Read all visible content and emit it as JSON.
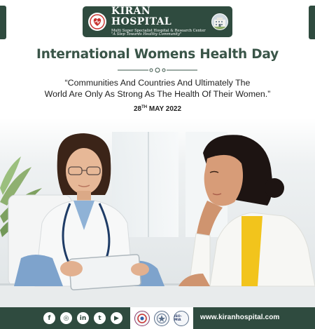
{
  "header": {
    "brand_name": "KIRAN HOSPITAL",
    "subtitle": "Multi Super Specialist Hospital & Research Center",
    "tagline": "\"A Step Towards Healthy Community\"",
    "logo_icon": "kiran-heart-logo-icon",
    "building_icon": "hospital-building-icon"
  },
  "title": "International Womens Health Day",
  "quote": {
    "line1": "“Communities And Countries And Ultimately The",
    "line2": "World Are Only As Strong As The Health Of Their Women.”"
  },
  "date": {
    "day": "28",
    "suffix": "TH",
    "rest": " MAY 2022"
  },
  "footer": {
    "social": [
      {
        "glyph": "f",
        "icon": "facebook-icon"
      },
      {
        "glyph": "◎",
        "icon": "instagram-icon"
      },
      {
        "glyph": "in",
        "icon": "linkedin-icon"
      },
      {
        "glyph": "t",
        "icon": "twitter-icon"
      },
      {
        "glyph": "▶",
        "icon": "youtube-icon"
      }
    ],
    "accreditations": [
      {
        "icon": "nabh-badge-icon"
      },
      {
        "icon": "iso-seal-icon"
      },
      {
        "label": "ISO-MIA",
        "icon": "mia-badge-icon"
      }
    ],
    "website": "www.kiranhospital.com"
  },
  "colors": {
    "brand_green": "#2f4b3f",
    "title_green": "#3a5548",
    "accent_yellow": "#f2c41c"
  }
}
